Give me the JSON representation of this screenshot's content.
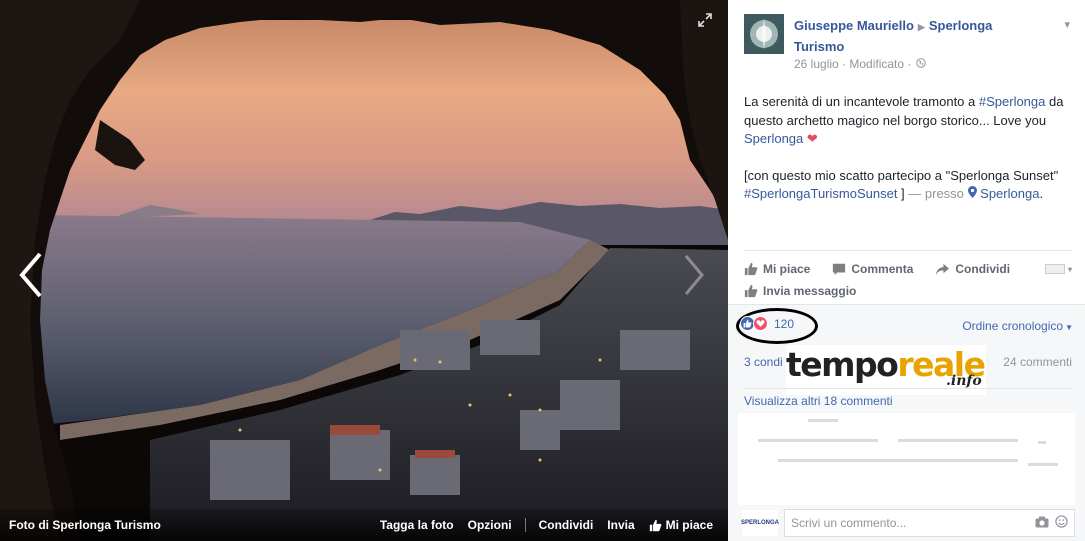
{
  "photo": {
    "source_label": "Foto di Sperlonga Turismo",
    "actions": [
      "Tagga la foto",
      "Opzioni",
      "Condividi",
      "Invia"
    ],
    "like_label": "Mi piace"
  },
  "post": {
    "author": "Giuseppe Mauriello",
    "page": "Sperlonga Turismo",
    "date": "26 luglio",
    "edited": "Modificato",
    "text1_pre": "La serenità di un incantevole tramonto a ",
    "hashtag1": "#Sperlonga",
    "text1_mid": " da questo archetto magico nel borgo storico... Love you ",
    "link1": "Sperlonga",
    "heart": "❤",
    "text2_pre": "[con questo mio scatto partecipo a \"Sperlonga Sunset\" ",
    "hashtag2": "#SperlongaTurismoSunset",
    "text2_post": " ]",
    "presso": " — presso ",
    "place": "Sperlonga",
    "place_suffix": "."
  },
  "actions": {
    "like": "Mi piace",
    "comment": "Commenta",
    "share": "Condividi",
    "message": "Invia messaggio"
  },
  "feedback": {
    "reaction_count": "120",
    "order": "Ordine cronologico",
    "shares_prefix": "3 condi",
    "comment_count": "24 commenti",
    "more_comments": "Visualizza altri 18 commenti",
    "placeholder": "Scrivi un commento..."
  },
  "watermark": {
    "part1": "tempo",
    "part2": "reale",
    "part3": ".info"
  },
  "colors": {
    "link": "#365899",
    "accent": "#4267b2",
    "love": "#f25268"
  }
}
